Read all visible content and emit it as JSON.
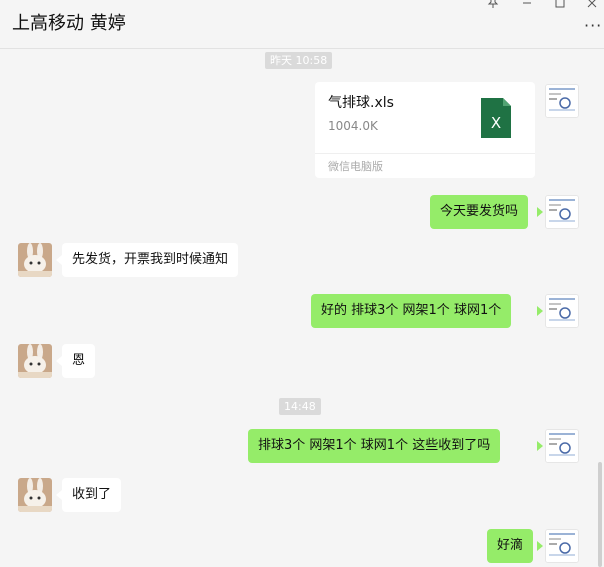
{
  "header": {
    "title": "上高移动 黄婷",
    "pin_icon": "pin-icon",
    "minimize_icon": "minimize-icon",
    "maximize_icon": "maximize-icon",
    "more_label": "···"
  },
  "chat": {
    "time_1": "昨天 10:58",
    "time_2": "14:48",
    "file": {
      "name": "气排球.xls",
      "size": "1004.0K",
      "source": "微信电脑版",
      "icon_letter": "X",
      "icon": "excel-file-icon"
    },
    "messages": [
      {
        "from": "self",
        "text": "今天要发货吗"
      },
      {
        "from": "other",
        "text": "先发货，开票我到时候通知"
      },
      {
        "from": "self",
        "text": "好的  排球3个  网架1个  球网1个"
      },
      {
        "from": "other",
        "text": "恩"
      },
      {
        "from": "self",
        "text": "排球3个  网架1个  球网1个   这些收到了吗"
      },
      {
        "from": "other",
        "text": "收到了"
      },
      {
        "from": "self",
        "text": "好滴"
      }
    ]
  },
  "colors": {
    "self_bubble": "#95ec69",
    "other_bubble": "#ffffff",
    "background": "#f5f5f5",
    "excel_green": "#1f7244"
  }
}
